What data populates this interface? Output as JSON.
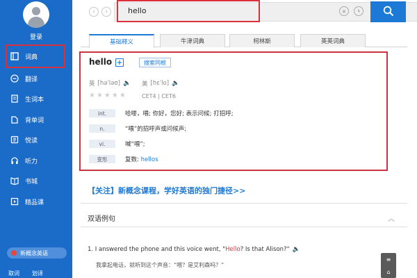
{
  "sidebar": {
    "login_label": "登录",
    "items": [
      {
        "label": "词典",
        "icon": "book-icon"
      },
      {
        "label": "翻译",
        "icon": "translate-icon"
      },
      {
        "label": "生词本",
        "icon": "wordbook-icon"
      },
      {
        "label": "背单词",
        "icon": "memorize-icon"
      },
      {
        "label": "悦读",
        "icon": "reading-icon"
      },
      {
        "label": "听力",
        "icon": "headphones-icon"
      },
      {
        "label": "书城",
        "icon": "bookstore-icon"
      },
      {
        "label": "精品课",
        "icon": "course-icon"
      }
    ],
    "promo_label": "新概念英语",
    "bottom_left": "取词",
    "bottom_right": "划译"
  },
  "search": {
    "value": "hello"
  },
  "tabs": [
    "基础释义",
    "牛津词典",
    "柯林斯",
    "英英词典"
  ],
  "definition": {
    "word": "hello",
    "same_root_tag": "搜索同根",
    "uk_label": "英",
    "uk_phonetic": "[həˈləʊ]",
    "us_label": "美",
    "us_phonetic": "[hɛˈlo]",
    "level": "CET4 | CET6",
    "rows": [
      {
        "pos": "int.",
        "meaning": "哈喽，喂; 你好，您好; 表示问候; 打招呼;"
      },
      {
        "pos": "n.",
        "meaning": "“喂”的招呼声或问候声;"
      },
      {
        "pos": "vi.",
        "meaning": "喊“喂”;"
      },
      {
        "pos": "变形",
        "meaning_prefix": "复数: ",
        "meaning_link": "hellos"
      }
    ]
  },
  "promo_link": "【关注】新概念课程，学好英语的独门捷径>>",
  "bilingual": {
    "title": "双语例句",
    "example_prefix": "1. I answered the phone and this voice went, \"",
    "example_highlight": "Hello",
    "example_suffix": "? Is that Alison?\"",
    "example_cn": "我拿起电话，就听到这个声音：“喂？是艾利森吗？”"
  },
  "colors": {
    "sidebar": "#1b6bc9",
    "accent": "#1c7ad6",
    "highlight_box": "#d9303c"
  }
}
